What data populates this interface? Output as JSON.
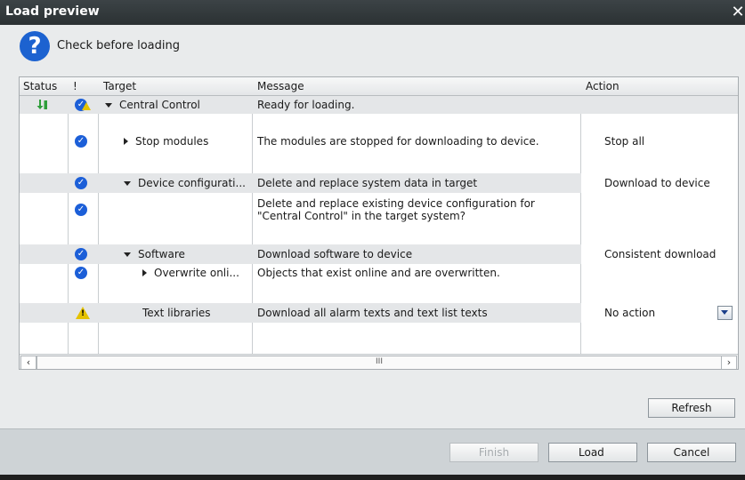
{
  "window": {
    "title": "Load preview",
    "close_glyph": "✕"
  },
  "header": {
    "icon": "question-icon",
    "icon_glyph": "?",
    "text": "Check before loading"
  },
  "columns": {
    "status": "Status",
    "exclaim": "!",
    "target": "Target",
    "message": "Message",
    "action": "Action"
  },
  "rows": [
    {
      "status_icon": "download-arrow-icon",
      "state_icon": "check-warning-icon",
      "expand": "down",
      "target": "Central Control",
      "message": "Ready for loading.",
      "action": ""
    },
    {
      "state_icon": "check-icon",
      "expand": "right",
      "target": "Stop modules",
      "message": "The modules are stopped for downloading to device.",
      "action": "Stop all"
    },
    {
      "state_icon": "check-icon",
      "expand": "down",
      "target": "Device configurati...",
      "message": "Delete and replace system data in target",
      "action": "Download to device"
    },
    {
      "state_icon": "check-icon",
      "target": "",
      "message_line1": "Delete and replace existing device configuration for",
      "message_line2": "\"Central Control\" in the target system?",
      "action": ""
    },
    {
      "state_icon": "check-icon",
      "expand": "down",
      "target": "Software",
      "message": "Download software to device",
      "action": "Consistent download"
    },
    {
      "state_icon": "check-icon",
      "expand": "right",
      "target": "Overwrite onli...",
      "message": "Objects that exist online and are overwritten.",
      "action": ""
    },
    {
      "state_icon": "warning-icon",
      "target": "Text libraries",
      "message": "Download all alarm texts and text list texts",
      "action": "No action"
    }
  ],
  "scrollbar": {
    "left": "‹",
    "right": "›",
    "thumb": "III"
  },
  "buttons": {
    "refresh": "Refresh",
    "finish": "Finish",
    "load": "Load",
    "cancel": "Cancel"
  }
}
